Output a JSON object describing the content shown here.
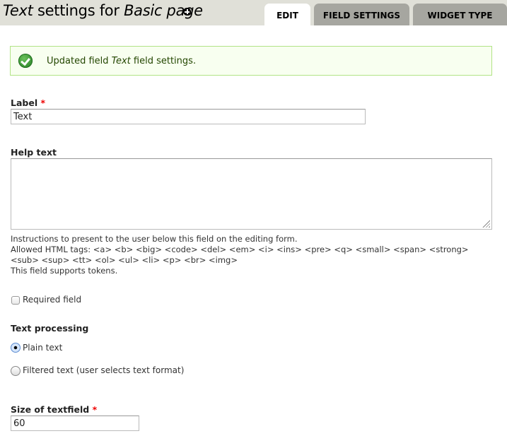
{
  "header": {
    "title_italic_1": "Text",
    "title_plain": " settings for ",
    "title_italic_2": "Basic page",
    "shortcut_icon": "plus-circle-icon"
  },
  "tabs": [
    {
      "label": "EDIT",
      "active": true
    },
    {
      "label": "FIELD SETTINGS",
      "active": false
    },
    {
      "label": "WIDGET TYPE",
      "active": false
    }
  ],
  "status": {
    "icon": "check-circle-icon",
    "prefix": "Updated field ",
    "field_name": "Text",
    "suffix": " field settings.",
    "colors": {
      "background": "#f8fff0",
      "border": "#b2e386",
      "icon": "#2f8f2a"
    }
  },
  "form": {
    "label_field": {
      "label": "Label",
      "required_mark": "*",
      "value": "Text"
    },
    "help_text": {
      "label": "Help text",
      "value": "",
      "description_lines": [
        "Instructions to present to the user below this field on the editing form.",
        "Allowed HTML tags: <a> <b> <big> <code> <del> <em> <i> <ins> <pre> <q> <small> <span> <strong>",
        "<sub> <sup> <tt> <ol> <ul> <li> <p> <br> <img>",
        "This field supports tokens."
      ]
    },
    "required_field": {
      "label": "Required field",
      "checked": false
    },
    "text_processing": {
      "label": "Text processing",
      "options": [
        {
          "label": "Plain text",
          "selected": true
        },
        {
          "label": "Filtered text (user selects text format)",
          "selected": false
        }
      ]
    },
    "size_of_textfield": {
      "label": "Size of textfield",
      "required_mark": "*",
      "value": "60"
    }
  }
}
